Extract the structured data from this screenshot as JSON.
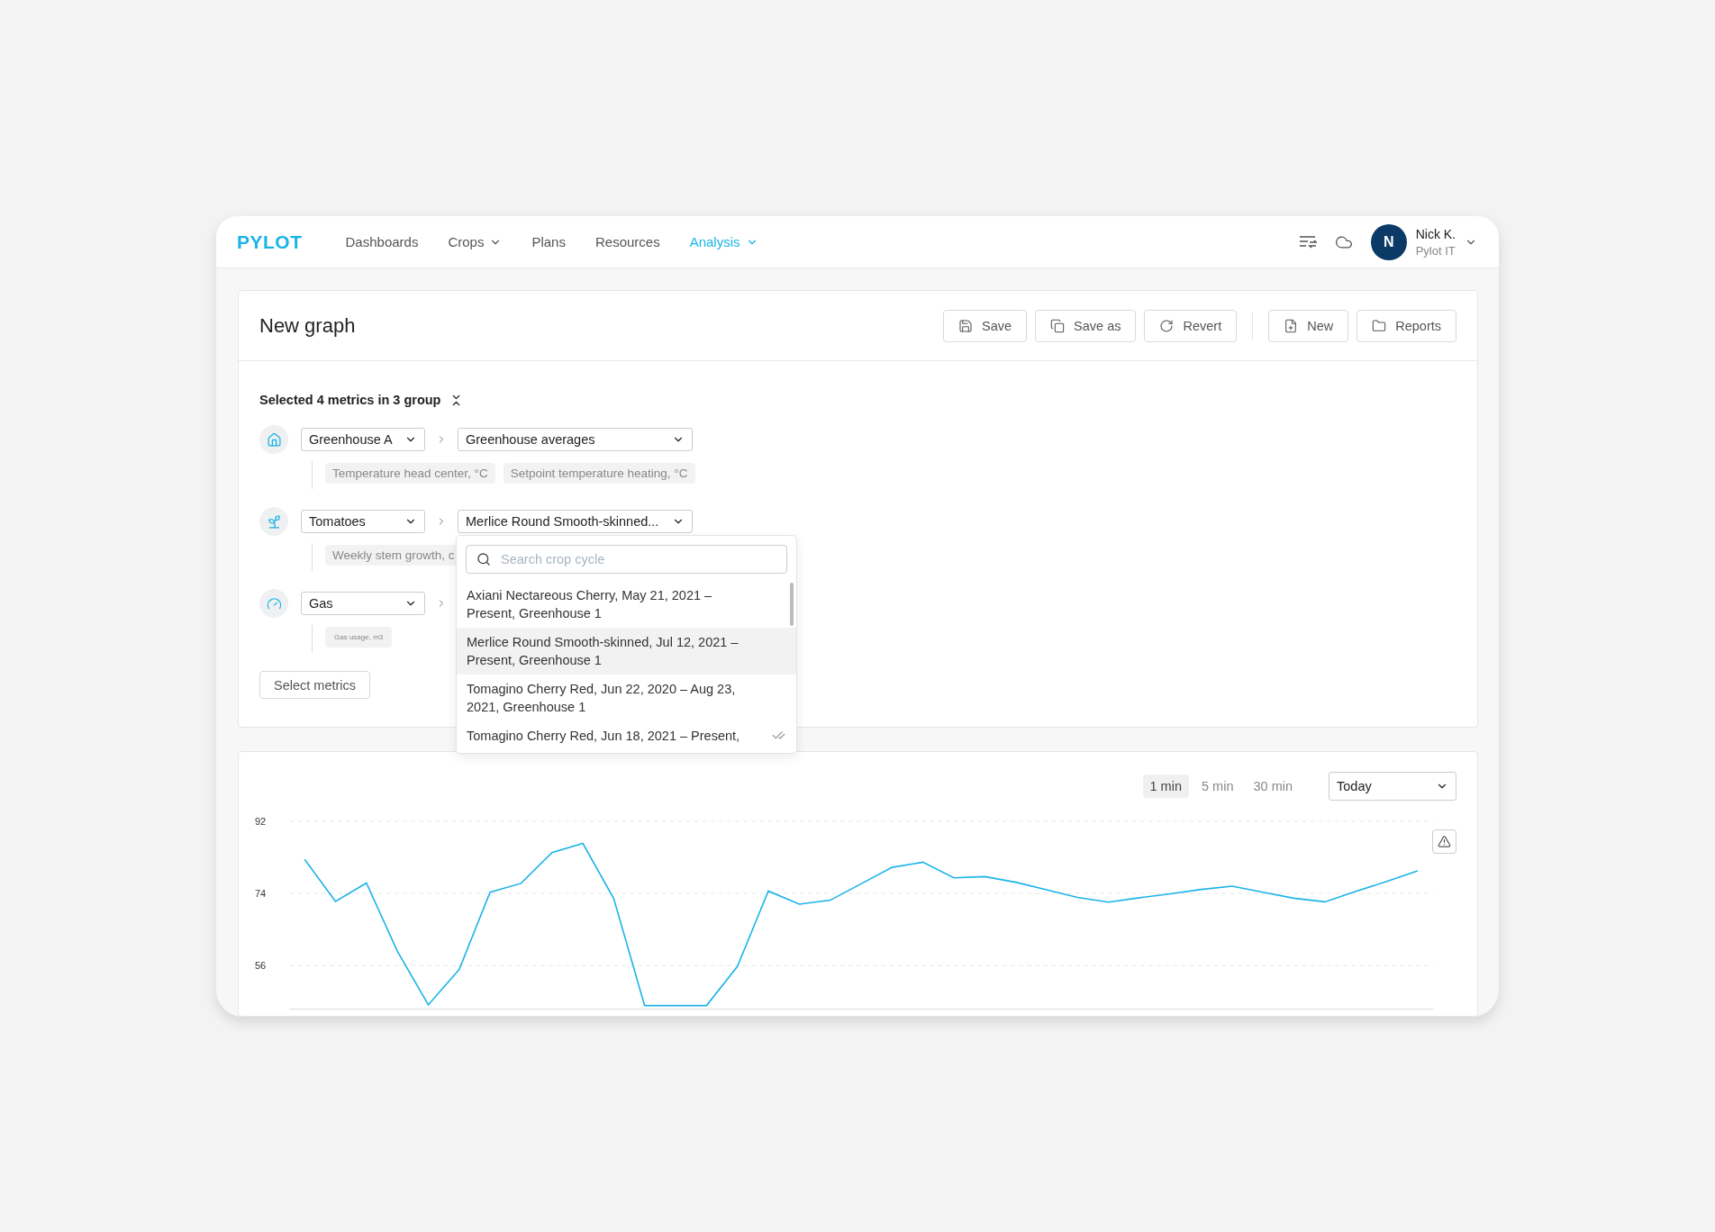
{
  "nav": {
    "logo": "PYLOT",
    "items": [
      {
        "label": "Dashboards",
        "selected": false,
        "has_menu": false
      },
      {
        "label": "Crops",
        "selected": false,
        "has_menu": true
      },
      {
        "label": "Plans",
        "selected": false,
        "has_menu": false
      },
      {
        "label": "Resources",
        "selected": false,
        "has_menu": false
      },
      {
        "label": "Analysis",
        "selected": true,
        "has_menu": true
      }
    ],
    "user": {
      "initial": "N",
      "name": "Nick K.",
      "org": "Pylot IT"
    }
  },
  "header": {
    "title": "New graph",
    "buttons": [
      {
        "label": "Save",
        "kind": "save",
        "separator_before": false
      },
      {
        "label": "Save as",
        "kind": "copy",
        "separator_before": false
      },
      {
        "label": "Revert",
        "kind": "revert",
        "separator_before": false
      },
      {
        "label": "New",
        "kind": "new",
        "separator_before": true
      },
      {
        "label": "Reports",
        "kind": "folder",
        "separator_before": false
      }
    ]
  },
  "metrics": {
    "summary": "Selected 4 metrics in 3 group",
    "groups": [
      {
        "kind": "greenhouse",
        "source": "Greenhouse A",
        "target": "Greenhouse averages",
        "chips": [
          {
            "label": "Temperature head center, °C",
            "kind": "regular"
          },
          {
            "label": "Setpoint temperature heating, °C",
            "kind": "regular"
          }
        ]
      },
      {
        "kind": "crop",
        "source": "Tomatoes",
        "target": "Merlice Round Smooth-skinned...",
        "chips": [
          {
            "label": "Weekly stem growth, c",
            "kind": "regular"
          }
        ]
      },
      {
        "kind": "gas",
        "source": "Gas",
        "chips": [
          {
            "label": "Gas usage, m3",
            "kind": "compact"
          }
        ]
      }
    ],
    "select_button": "Select metrics"
  },
  "dropdown": {
    "placeholder": "Search crop cycle",
    "options": [
      {
        "label": "Axiani Nectareous Cherry, May 21, 2021 – Present, Greenhouse 1",
        "highlighted": false,
        "checked": false
      },
      {
        "label": "Merlice Round Smooth-skinned, Jul 12, 2021 – Present, Greenhouse 1",
        "highlighted": true,
        "checked": false
      },
      {
        "label": "Tomagino Cherry Red, Jun 22, 2020 – Aug 23, 2021, Greenhouse 1",
        "highlighted": false,
        "checked": false
      },
      {
        "label": "Tomagino Cherry Red, Jun 18, 2021 – Present,",
        "highlighted": false,
        "checked": true
      }
    ]
  },
  "chart": {
    "intervals": [
      {
        "label": "1 min",
        "selected": true
      },
      {
        "label": "5 min",
        "selected": false
      },
      {
        "label": "30 min",
        "selected": false
      }
    ],
    "range": "Today",
    "chart_data": {
      "type": "line",
      "categories": [
        null,
        null,
        null,
        null,
        null,
        null,
        null,
        null,
        null,
        null,
        null,
        null,
        null,
        null,
        null,
        null,
        null,
        null,
        null,
        null,
        null,
        null,
        null,
        null,
        null,
        null,
        null,
        null,
        null,
        null,
        null,
        null,
        null,
        null,
        null,
        null,
        null
      ],
      "series": [
        {
          "color": "#1ab4e8",
          "values": [
            82.5,
            72.0,
            76.6,
            59.6,
            46.2,
            55.0,
            74.3,
            76.5,
            84.2,
            86.5,
            72.7,
            46,
            46,
            46,
            55.8,
            74.6,
            71.3,
            72.3,
            76.4,
            80.5,
            81.8,
            77.9,
            78.2,
            76.8,
            74.9,
            73.0,
            71.8,
            72.9,
            73.9,
            75.0,
            75.8,
            74.3,
            72.8,
            71.9,
            74.5,
            77.0,
            79.6
          ]
        }
      ],
      "grid": true,
      "ylim": [
        45,
        92
      ],
      "yticks": [
        {
          "value": 56,
          "label": "56"
        },
        {
          "value": 74,
          "label": "74"
        },
        {
          "value": 92,
          "label": "92"
        }
      ]
    }
  }
}
